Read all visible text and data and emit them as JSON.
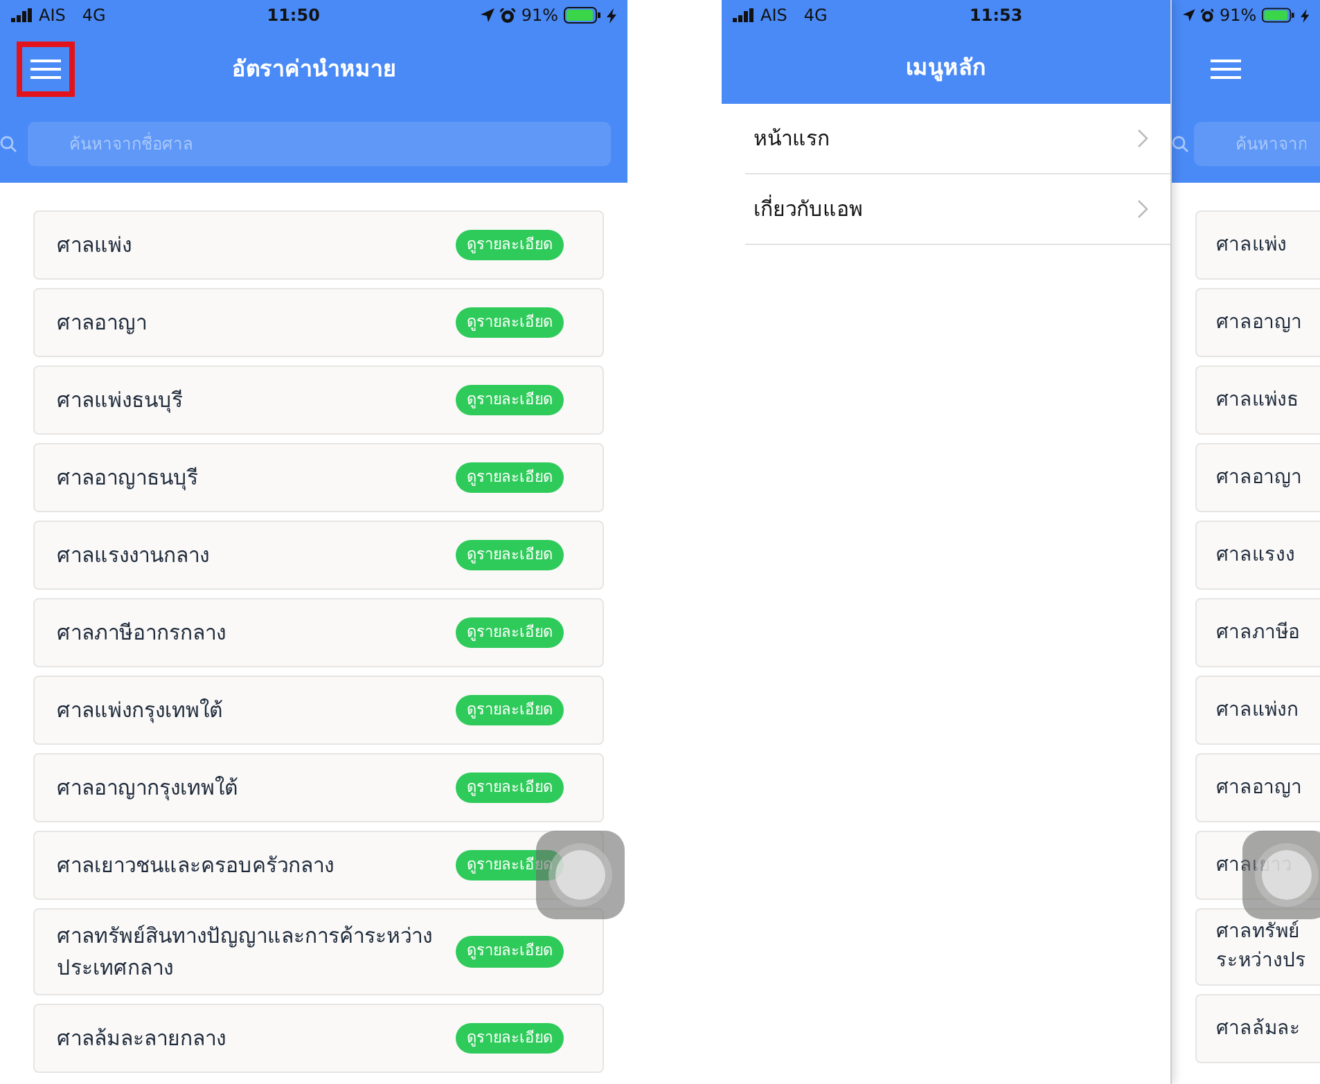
{
  "screens": [
    {
      "kind": "main",
      "status_bar": {
        "carrier": "AIS",
        "network": "4G",
        "time": "11:50",
        "battery": "91%"
      },
      "title": "อัตราค่านำหมาย",
      "menu_highlighted": true,
      "search": {
        "placeholder": "ค้นหาจากชื่อศาล"
      },
      "courts": [
        {
          "name": "ศาลแพ่ง",
          "button": "ดูรายละเอียด"
        },
        {
          "name": "ศาลอาญา",
          "button": "ดูรายละเอียด"
        },
        {
          "name": "ศาลแพ่งธนบุรี",
          "button": "ดูรายละเอียด"
        },
        {
          "name": "ศาลอาญาธนบุรี",
          "button": "ดูรายละเอียด"
        },
        {
          "name": "ศาลแรงงานกลาง",
          "button": "ดูรายละเอียด"
        },
        {
          "name": "ศาลภาษีอากรกลาง",
          "button": "ดูรายละเอียด"
        },
        {
          "name": "ศาลแพ่งกรุงเทพใต้",
          "button": "ดูรายละเอียด"
        },
        {
          "name": "ศาลอาญากรุงเทพใต้",
          "button": "ดูรายละเอียด"
        },
        {
          "name": "ศาลเยาวชนและครอบครัวกลาง",
          "button": "ดูรายละเอียด"
        },
        {
          "name": "ศาลทรัพย์สินทางปัญญาและการค้าระหว่างประเทศกลาง",
          "button": "ดูรายละเอียด"
        },
        {
          "name": "ศาลล้มละลายกลาง",
          "button": "ดูรายละเอียด"
        }
      ]
    },
    {
      "kind": "drawer",
      "status_bar": {
        "carrier": "AIS",
        "network": "4G",
        "time": "11:53",
        "battery": "91%"
      },
      "title": "เมนูหลัก",
      "menu_items": [
        {
          "label": "หน้าแรก"
        },
        {
          "label": "เกี่ยวกับแอพ"
        }
      ],
      "behind": {
        "search": {
          "placeholder": "ค้นหาจาก"
        },
        "courts": [
          {
            "lines": [
              "ศาลแพ่ง"
            ]
          },
          {
            "lines": [
              "ศาลอาญา"
            ]
          },
          {
            "lines": [
              "ศาลแพ่งธ"
            ]
          },
          {
            "lines": [
              "ศาลอาญา"
            ]
          },
          {
            "lines": [
              "ศาลแรงง"
            ]
          },
          {
            "lines": [
              "ศาลภาษีอ"
            ]
          },
          {
            "lines": [
              "ศาลแพ่งก"
            ]
          },
          {
            "lines": [
              "ศาลอาญา"
            ]
          },
          {
            "lines": [
              "ศาลเยาว"
            ]
          },
          {
            "lines": [
              "ศาลทรัพย์",
              "ระหว่างปร"
            ]
          },
          {
            "lines": [
              "ศาลล้มละ"
            ]
          }
        ]
      }
    }
  ]
}
